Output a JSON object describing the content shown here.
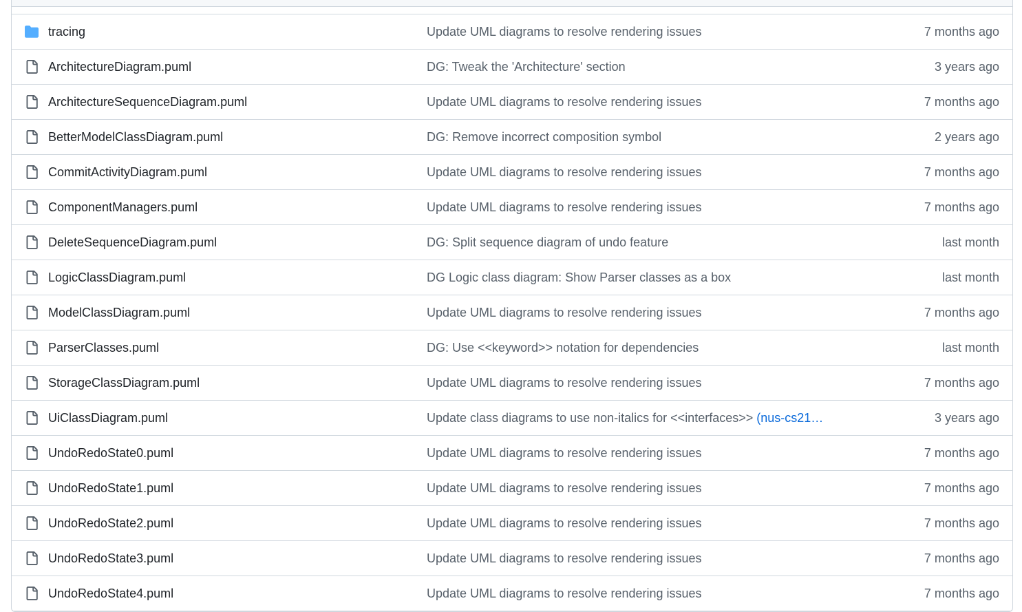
{
  "colors": {
    "folder_icon": "#54aeff",
    "file_icon": "#57606a",
    "link": "#0969da",
    "border": "#d0d7de"
  },
  "rows": [
    {
      "type": "folder",
      "icon": "folder-icon",
      "name": "tracing",
      "message": "Update UML diagrams to resolve rendering issues",
      "age": "7 months ago"
    },
    {
      "type": "file",
      "icon": "file-icon",
      "name": "ArchitectureDiagram.puml",
      "message": "DG: Tweak the 'Architecture' section",
      "age": "3 years ago"
    },
    {
      "type": "file",
      "icon": "file-icon",
      "name": "ArchitectureSequenceDiagram.puml",
      "message": "Update UML diagrams to resolve rendering issues",
      "age": "7 months ago"
    },
    {
      "type": "file",
      "icon": "file-icon",
      "name": "BetterModelClassDiagram.puml",
      "message": "DG: Remove incorrect composition symbol",
      "age": "2 years ago"
    },
    {
      "type": "file",
      "icon": "file-icon",
      "name": "CommitActivityDiagram.puml",
      "message": "Update UML diagrams to resolve rendering issues",
      "age": "7 months ago"
    },
    {
      "type": "file",
      "icon": "file-icon",
      "name": "ComponentManagers.puml",
      "message": "Update UML diagrams to resolve rendering issues",
      "age": "7 months ago"
    },
    {
      "type": "file",
      "icon": "file-icon",
      "name": "DeleteSequenceDiagram.puml",
      "message": "DG: Split sequence diagram of undo feature",
      "age": "last month"
    },
    {
      "type": "file",
      "icon": "file-icon",
      "name": "LogicClassDiagram.puml",
      "message": "DG Logic class diagram: Show Parser classes as a box",
      "age": "last month"
    },
    {
      "type": "file",
      "icon": "file-icon",
      "name": "ModelClassDiagram.puml",
      "message": "Update UML diagrams to resolve rendering issues",
      "age": "7 months ago"
    },
    {
      "type": "file",
      "icon": "file-icon",
      "name": "ParserClasses.puml",
      "message": "DG: Use <<keyword>> notation for dependencies",
      "age": "last month"
    },
    {
      "type": "file",
      "icon": "file-icon",
      "name": "StorageClassDiagram.puml",
      "message": "Update UML diagrams to resolve rendering issues",
      "age": "7 months ago"
    },
    {
      "type": "file",
      "icon": "file-icon",
      "name": "UiClassDiagram.puml",
      "message": "Update class diagrams to use non-italics for <<interfaces>> ",
      "pr_link": "(nus-cs21…",
      "age": "3 years ago"
    },
    {
      "type": "file",
      "icon": "file-icon",
      "name": "UndoRedoState0.puml",
      "message": "Update UML diagrams to resolve rendering issues",
      "age": "7 months ago"
    },
    {
      "type": "file",
      "icon": "file-icon",
      "name": "UndoRedoState1.puml",
      "message": "Update UML diagrams to resolve rendering issues",
      "age": "7 months ago"
    },
    {
      "type": "file",
      "icon": "file-icon",
      "name": "UndoRedoState2.puml",
      "message": "Update UML diagrams to resolve rendering issues",
      "age": "7 months ago"
    },
    {
      "type": "file",
      "icon": "file-icon",
      "name": "UndoRedoState3.puml",
      "message": "Update UML diagrams to resolve rendering issues",
      "age": "7 months ago"
    },
    {
      "type": "file",
      "icon": "file-icon",
      "name": "UndoRedoState4.puml",
      "message": "Update UML diagrams to resolve rendering issues",
      "age": "7 months ago"
    }
  ]
}
